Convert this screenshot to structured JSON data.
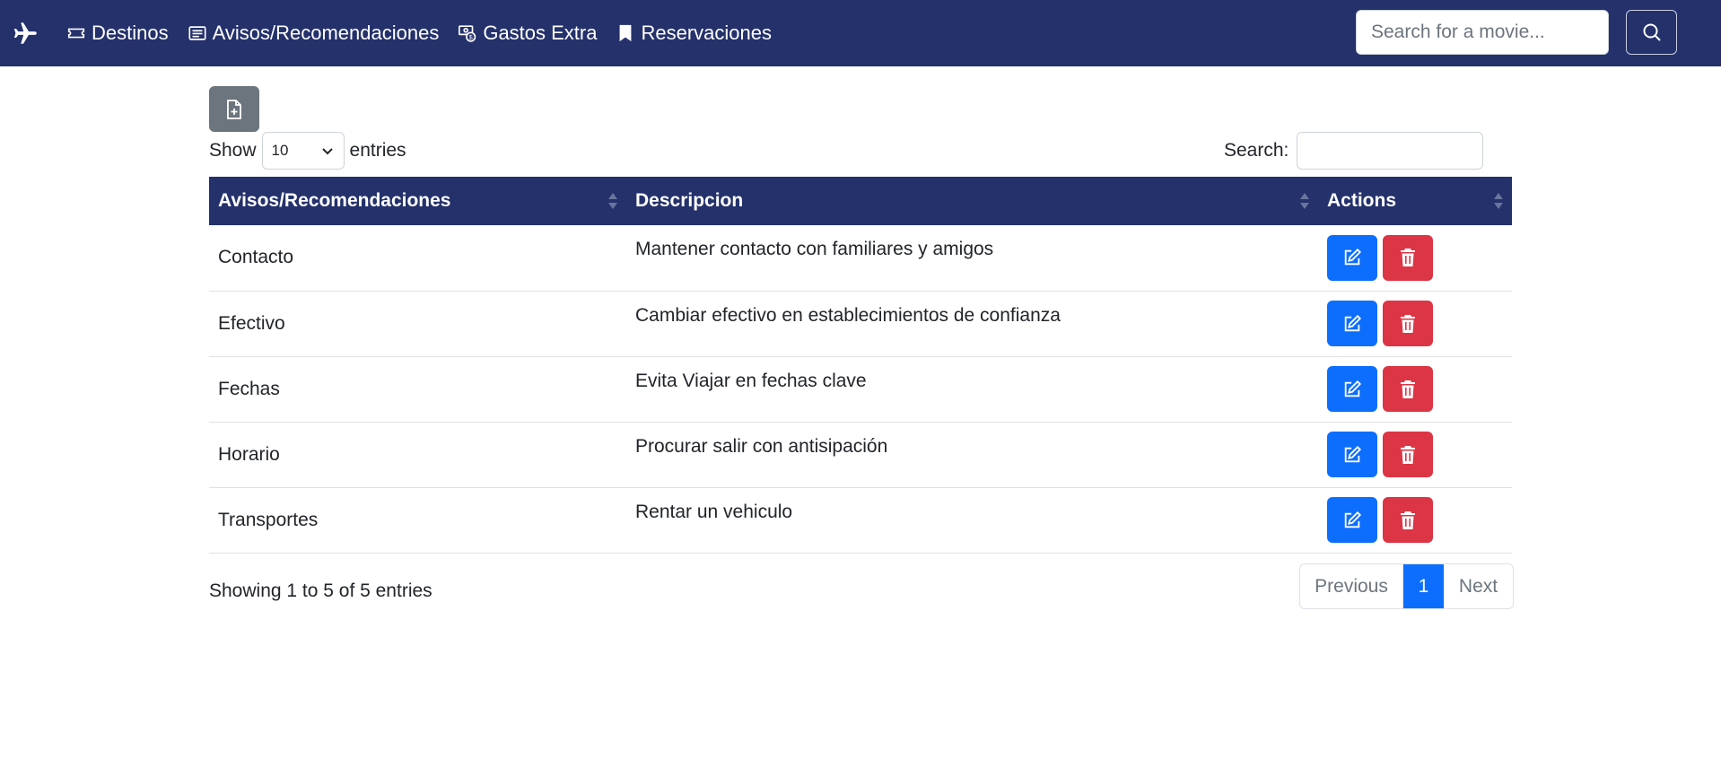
{
  "navbar": {
    "brand_icon": "plane-icon",
    "links": [
      {
        "label": "Destinos",
        "icon": "ticket-icon"
      },
      {
        "label": "Avisos/Recomendaciones",
        "icon": "card-text-icon"
      },
      {
        "label": "Gastos Extra",
        "icon": "cash-coin-icon"
      },
      {
        "label": "Reservaciones",
        "icon": "bookmark-icon"
      }
    ],
    "search": {
      "placeholder": "Search for a movie..."
    },
    "search_button_icon": "search-icon",
    "color": "#24316b"
  },
  "toolbar": {
    "new_button_icon": "file-plus-icon"
  },
  "length": {
    "prefix": "Show",
    "selected": "10",
    "suffix": "entries"
  },
  "filter": {
    "label": "Search:",
    "value": ""
  },
  "table": {
    "headers": [
      "Avisos/Recomendaciones",
      "Descripcion",
      "Actions"
    ],
    "rows": [
      {
        "name": "Contacto",
        "description": "Mantener contacto con familiares y amigos"
      },
      {
        "name": "Efectivo",
        "description": "Cambiar efectivo en establecimientos de confianza"
      },
      {
        "name": "Fechas",
        "description": "Evita Viajar en fechas clave"
      },
      {
        "name": "Horario",
        "description": "Procurar salir con antisipación"
      },
      {
        "name": "Transportes",
        "description": "Rentar un vehiculo"
      }
    ],
    "edit_icon": "pencil-square-icon",
    "delete_icon": "trash-icon"
  },
  "info": "Showing 1 to 5 of 5 entries",
  "pagination": {
    "previous": "Previous",
    "current": "1",
    "next": "Next"
  },
  "colors": {
    "primary": "#0d6efd",
    "danger": "#dc3545",
    "secondary": "#6c757d",
    "header": "#24316b"
  }
}
